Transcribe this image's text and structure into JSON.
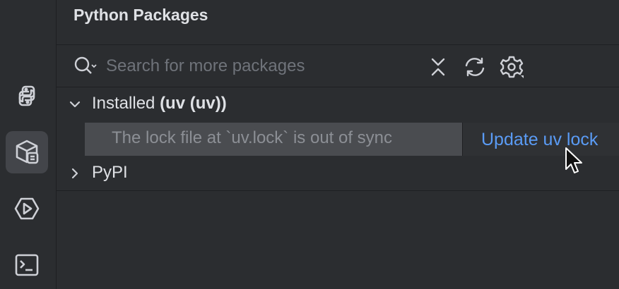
{
  "panel": {
    "title": "Python Packages"
  },
  "search": {
    "placeholder": "Search for more packages",
    "value": ""
  },
  "toolbar": {
    "icons": [
      "collapse-all-icon",
      "refresh-icon",
      "settings-icon"
    ]
  },
  "sidebar": {
    "items": [
      {
        "name": "python-console",
        "icon": "python-icon",
        "active": false
      },
      {
        "name": "python-packages",
        "icon": "packages-icon",
        "active": true
      },
      {
        "name": "services",
        "icon": "run-icon",
        "active": false
      },
      {
        "name": "terminal",
        "icon": "terminal-icon",
        "active": false
      }
    ]
  },
  "tree": {
    "installed": {
      "label": "Installed ",
      "manager": "(uv (uv))",
      "expanded": true
    },
    "notice": {
      "message": "The lock file at `uv.lock` is out of sync",
      "action": "Update uv lock"
    },
    "pypi": {
      "label": "PyPI",
      "expanded": false
    }
  },
  "colors": {
    "background": "#2b2d30",
    "link": "#5a9bf5",
    "notice_bg": "#4a4c50",
    "active_sidebar": "#43454a"
  }
}
